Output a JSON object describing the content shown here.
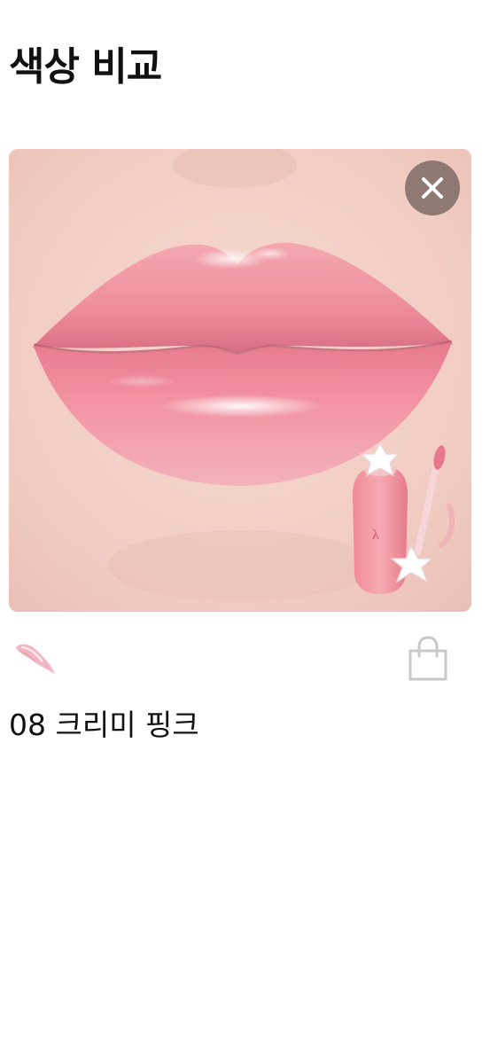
{
  "header": {
    "title": "색상 비교"
  },
  "product_image": {
    "alt_subject": "lips",
    "close_icon": "close-icon"
  },
  "swatch": {
    "icon": "texture-swatch-icon",
    "color": "#f2b6c2"
  },
  "actions": {
    "bag_icon": "shopping-bag-icon"
  },
  "shade": {
    "name": "08 크리미 핑크"
  },
  "colors": {
    "lip": "#f08fa0",
    "skin": "#f3d2c8",
    "close_bg": "#786862",
    "icon_gray": "#c8c8c8"
  }
}
